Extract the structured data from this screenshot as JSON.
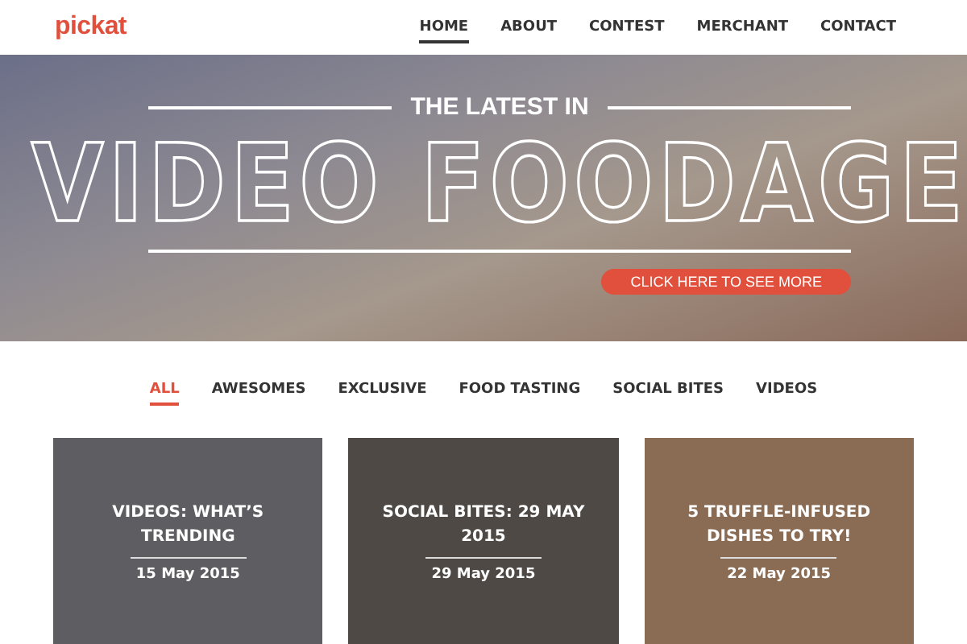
{
  "brand": "pickat",
  "nav": [
    {
      "label": "HOME",
      "selected": true
    },
    {
      "label": "ABOUT",
      "selected": false
    },
    {
      "label": "CONTEST",
      "selected": false
    },
    {
      "label": "MERCHANT",
      "selected": false
    },
    {
      "label": "CONTACT",
      "selected": false
    }
  ],
  "hero": {
    "kicker": "THE LATEST IN",
    "title": "VIDEO FOODAGE",
    "button": "CLICK HERE TO SEE MORE"
  },
  "filters": [
    {
      "label": "ALL",
      "selected": true
    },
    {
      "label": "AWESOMES",
      "selected": false
    },
    {
      "label": "EXCLUSIVE",
      "selected": false
    },
    {
      "label": "FOOD TASTING",
      "selected": false
    },
    {
      "label": "SOCIAL BITES",
      "selected": false
    },
    {
      "label": "VIDEOS",
      "selected": false
    }
  ],
  "posts": [
    {
      "title": "VIDEOS: WHAT’S TRENDING",
      "date": "15 May 2015"
    },
    {
      "title": "SOCIAL BITES: 29 MAY 2015",
      "date": "29 May 2015"
    },
    {
      "title": "5 TRUFFLE-INFUSED DISHES TO TRY!",
      "date": "22 May 2015"
    }
  ]
}
